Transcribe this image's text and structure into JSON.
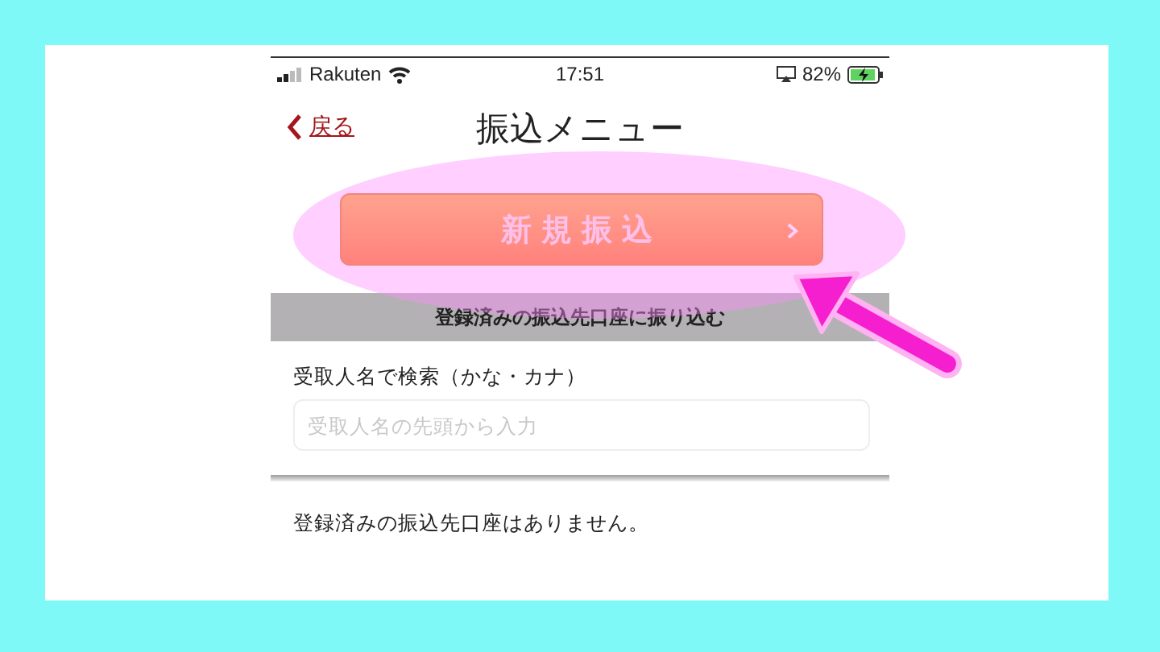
{
  "status_bar": {
    "carrier": "Rakuten",
    "time": "17:51",
    "battery": "82%"
  },
  "header": {
    "back": "戻る",
    "title": "振込メニュー"
  },
  "new_transfer_button": {
    "label": "新規振込"
  },
  "section_header": "登録済みの振込先口座に振り込む",
  "search": {
    "label": "受取人名で検索（かな・カナ）",
    "placeholder": "受取人名の先頭から入力"
  },
  "empty_message": "登録済みの振込先口座はありません。"
}
